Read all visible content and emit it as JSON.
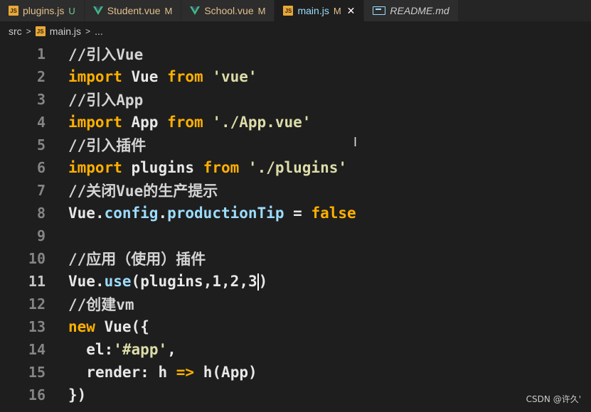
{
  "tabs": [
    {
      "name": "plugins.js",
      "status": "U",
      "icon": "js-icon",
      "active": false
    },
    {
      "name": "Student.vue",
      "status": "M",
      "icon": "vue-icon",
      "active": false
    },
    {
      "name": "School.vue",
      "status": "M",
      "icon": "vue-icon",
      "active": false
    },
    {
      "name": "main.js",
      "status": "M",
      "icon": "js-icon",
      "active": true,
      "close": "✕"
    },
    {
      "name": "README.md",
      "status": "",
      "icon": "markdown-icon",
      "active": false
    }
  ],
  "breadcrumb": {
    "folder": "src",
    "sep": ">",
    "file": "main.js",
    "more": "..."
  },
  "editor": {
    "current_line": 11,
    "lines": [
      {
        "n": "1",
        "t": "//引入Vue"
      },
      {
        "n": "2",
        "t": "import Vue from 'vue'"
      },
      {
        "n": "3",
        "t": "//引入App"
      },
      {
        "n": "4",
        "t": "import App from './App.vue'"
      },
      {
        "n": "5",
        "t": "//引入插件"
      },
      {
        "n": "6",
        "t": "import plugins from './plugins'"
      },
      {
        "n": "7",
        "t": "//关闭Vue的生产提示"
      },
      {
        "n": "8",
        "t": "Vue.config.productionTip = false"
      },
      {
        "n": "9",
        "t": ""
      },
      {
        "n": "10",
        "t": "//应用（使用）插件"
      },
      {
        "n": "11",
        "t": "Vue.use(plugins,1,2,3)"
      },
      {
        "n": "12",
        "t": "//创建vm"
      },
      {
        "n": "13",
        "t": "new Vue({"
      },
      {
        "n": "14",
        "t": "  el:'#app',"
      },
      {
        "n": "15",
        "t": "  render: h => h(App)"
      },
      {
        "n": "16",
        "t": "})"
      }
    ]
  },
  "watermark": "CSDN @许久'",
  "colors": {
    "background": "#1e1e1e",
    "keyword": "#ffb000",
    "property": "#9cdcfe",
    "string": "#dcdcaa"
  }
}
